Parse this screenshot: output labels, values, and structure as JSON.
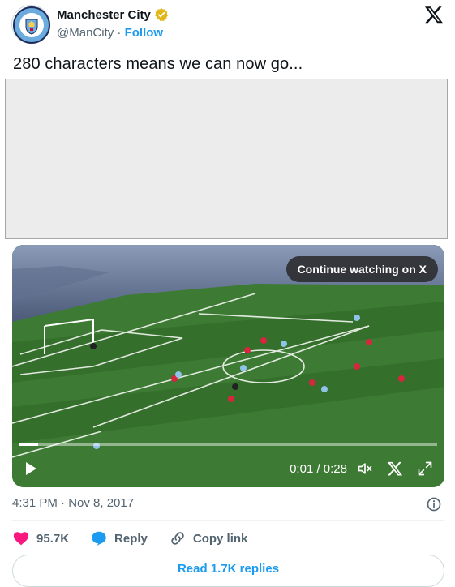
{
  "account": {
    "name": "Manchester City",
    "handle": "@ManCity",
    "separator": "·",
    "follow_label": "Follow",
    "badge_lettering": "MANCHESTER CITY"
  },
  "tweet": {
    "text": "280 characters means we can now go..."
  },
  "video": {
    "continue_label": "Continue watching on X",
    "time": "0:01 / 0:28",
    "progress_fraction": 0.045
  },
  "meta": {
    "timestamp": "4:31 PM · Nov 8, 2017"
  },
  "actions": {
    "likes_count": "95.7K",
    "reply_label": "Reply",
    "copy_label": "Copy link",
    "read_replies_label": "Read 1.7K replies"
  },
  "colors": {
    "accent": "#1d9bf0",
    "like": "#f91880",
    "verified": "#e2b719",
    "text": "#0f1419",
    "muted": "#536471"
  },
  "icons": [
    "verified-badge-icon",
    "x-logo-icon",
    "play-icon",
    "volume-icon",
    "expand-icon",
    "info-icon",
    "heart-icon",
    "reply-bubble-icon",
    "link-icon"
  ]
}
